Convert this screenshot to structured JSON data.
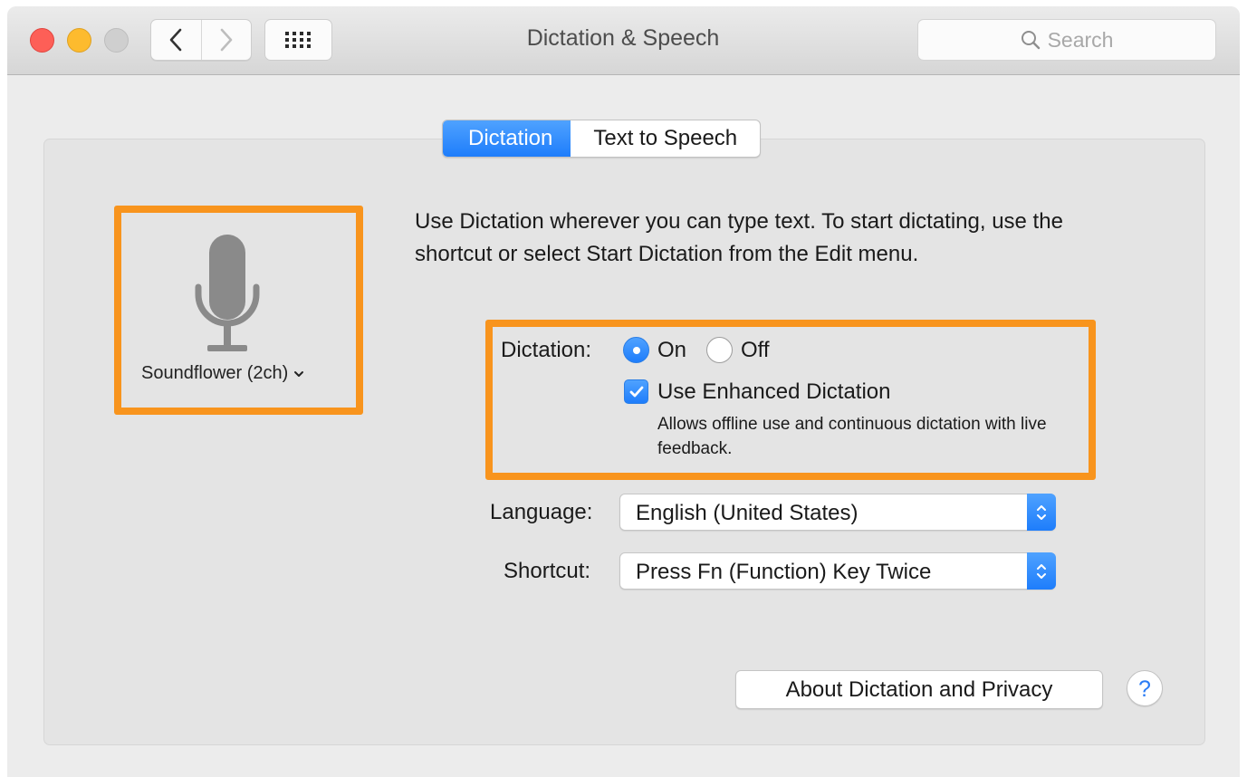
{
  "window": {
    "title": "Dictation & Speech",
    "search_placeholder": "Search"
  },
  "toolbar": {
    "back_icon": "chevron-left-icon",
    "forward_icon": "chevron-right-icon",
    "show_all_icon": "grid-icon"
  },
  "tabs": [
    {
      "label": "Dictation",
      "selected": true
    },
    {
      "label": "Text to Speech",
      "selected": false
    }
  ],
  "microphone": {
    "icon": "microphone-icon",
    "device": "Soundflower (2ch)"
  },
  "description": "Use Dictation wherever you can type text. To start dictating, use the shortcut or select Start Dictation from the Edit menu.",
  "dictation": {
    "label": "Dictation:",
    "on_label": "On",
    "off_label": "Off",
    "selected": "On",
    "enhanced_label": "Use Enhanced Dictation",
    "enhanced_checked": true,
    "enhanced_desc": "Allows offline use and continuous dictation with live feedback."
  },
  "language": {
    "label": "Language:",
    "value": "English (United States)"
  },
  "shortcut": {
    "label": "Shortcut:",
    "value": "Press Fn (Function) Key Twice"
  },
  "buttons": {
    "about": "About Dictation and Privacy",
    "help": "?"
  },
  "colors": {
    "accent": "#1e7dfb",
    "highlight": "#f8941d"
  }
}
